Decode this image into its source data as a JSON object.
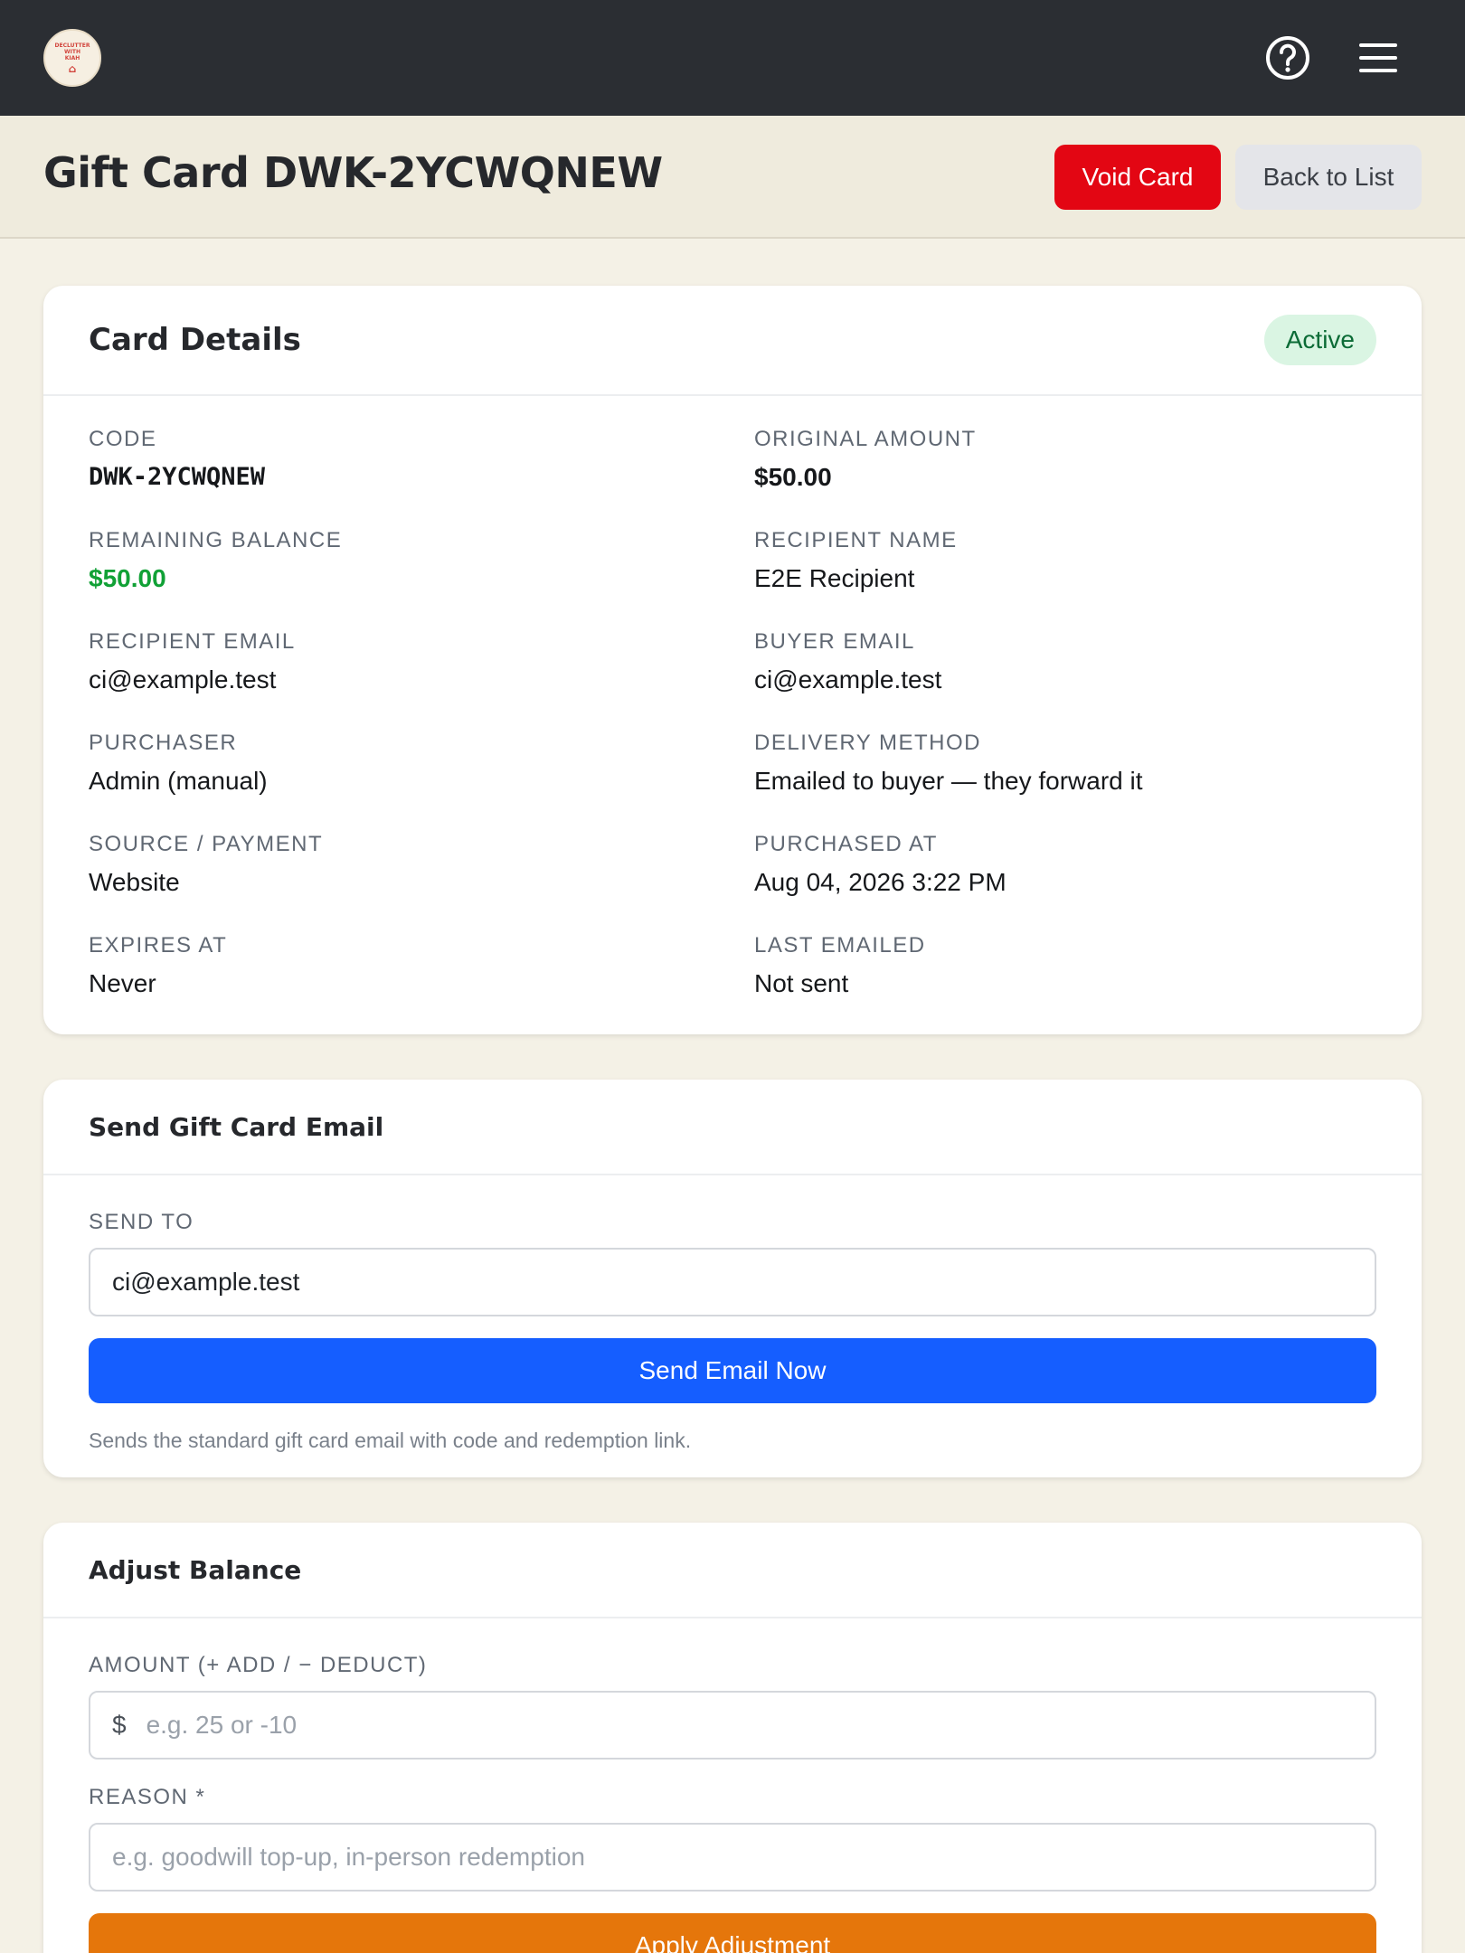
{
  "topbar": {
    "logo_text": "DECLUTTER WITH KIAH",
    "icons": [
      "help-circle-icon",
      "hamburger-menu-icon"
    ]
  },
  "header": {
    "title": "Gift Card DWK-2YCWQNEW",
    "void_label": "Void Card",
    "back_label": "Back to List"
  },
  "details": {
    "title": "Card Details",
    "status": "Active",
    "fields": [
      {
        "label": "CODE",
        "value": "DWK-2YCWQNEW"
      },
      {
        "label": "ORIGINAL AMOUNT",
        "value": "$50.00"
      },
      {
        "label": "REMAINING BALANCE",
        "value": "$50.00"
      },
      {
        "label": "RECIPIENT NAME",
        "value": "E2E Recipient"
      },
      {
        "label": "RECIPIENT EMAIL",
        "value": "ci@example.test"
      },
      {
        "label": "BUYER EMAIL",
        "value": "ci@example.test"
      },
      {
        "label": "PURCHASER",
        "value": "Admin (manual)"
      },
      {
        "label": "DELIVERY METHOD",
        "value": "Emailed to buyer — they forward it"
      },
      {
        "label": "SOURCE / PAYMENT",
        "value": "Website"
      },
      {
        "label": "PURCHASED AT",
        "value": "Aug 04, 2026 3:22 PM"
      },
      {
        "label": "EXPIRES AT",
        "value": "Never"
      },
      {
        "label": "LAST EMAILED",
        "value": "Not sent"
      }
    ]
  },
  "send_email": {
    "title": "Send Gift Card Email",
    "send_to_label": "SEND TO",
    "send_to_value": "ci@example.test",
    "button_label": "Send Email Now",
    "hint": "Sends the standard gift card email with code and redemption link."
  },
  "adjust": {
    "title": "Adjust Balance",
    "amount_label": "AMOUNT (+ ADD / − DEDUCT)",
    "currency_prefix": "$",
    "amount_placeholder": "e.g. 25 or -10",
    "reason_label": "REASON *",
    "reason_placeholder": "e.g. goodwill top-up, in-person redemption",
    "button_label": "Apply Adjustment"
  },
  "colors": {
    "topbar": "#2b2e33",
    "void": "#e30613",
    "send": "#155eff",
    "apply": "#e5760b",
    "balance": "#11a136",
    "active_badge": "#daf5e3"
  }
}
